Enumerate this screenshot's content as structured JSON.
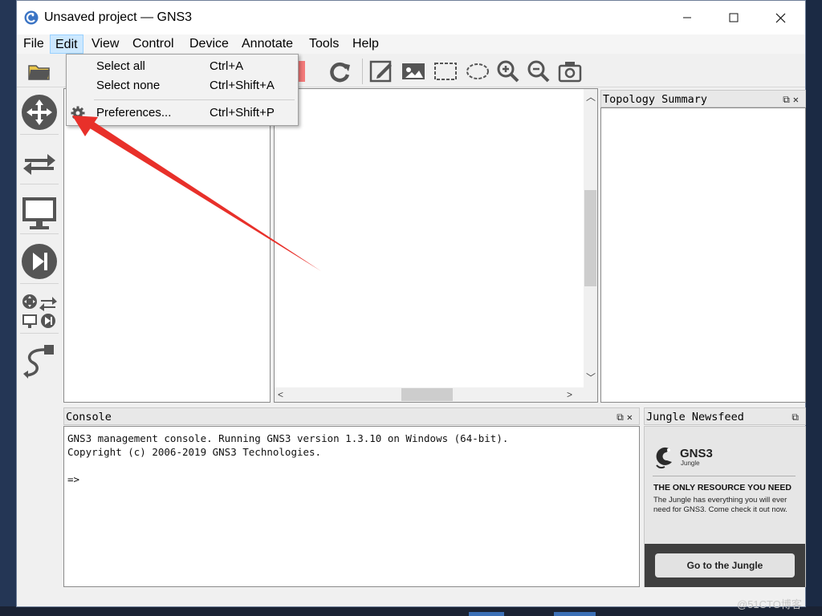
{
  "window": {
    "title": "Unsaved project — GNS3",
    "controls": [
      "minimize-icon",
      "maximize-icon",
      "close-icon"
    ]
  },
  "menubar": {
    "items": [
      "File",
      "Edit",
      "View",
      "Control",
      "Device",
      "Annotate",
      "Tools",
      "Help"
    ],
    "active": "Edit"
  },
  "edit_menu": {
    "items": [
      {
        "label": "Select all",
        "shortcut": "Ctrl+A"
      },
      {
        "label": "Select none",
        "shortcut": "Ctrl+Shift+A"
      },
      {
        "label": "Preferences...",
        "shortcut": "Ctrl+Shift+P",
        "icon": "gear-icon"
      }
    ]
  },
  "toolbar": {
    "icons": [
      "open-folder-icon",
      "stop-icon",
      "reload-icon",
      "add-note-icon",
      "insert-picture-icon",
      "draw-rectangle-icon",
      "draw-ellipse-icon",
      "zoom-in-icon",
      "zoom-out-icon",
      "screenshot-icon"
    ]
  },
  "device_bar": {
    "icons": [
      "routers-icon",
      "switches-icon",
      "end-devices-icon",
      "security-devices-icon",
      "all-devices-icon",
      "add-link-icon"
    ]
  },
  "topology_summary": {
    "title": "Topology Summary"
  },
  "console": {
    "title": "Console",
    "lines": [
      "GNS3 management console. Running GNS3 version 1.3.10 on Windows (64-bit).",
      "Copyright (c) 2006-2019 GNS3 Technologies.",
      "",
      "=>"
    ]
  },
  "jungle": {
    "title": "Jungle Newsfeed",
    "brand": "GNS3",
    "brand_sub": "Jungle",
    "headline": "THE ONLY RESOURCE YOU NEED",
    "body": "The Jungle has everything you will ever need for GNS3. Come check it out now.",
    "button": "Go to the Jungle"
  },
  "colors": {
    "annotation_arrow": "#e8302a",
    "menu_highlight": "#cce8ff",
    "jungle_footer": "#3f3f3f"
  },
  "watermark": "@51CTO博客"
}
